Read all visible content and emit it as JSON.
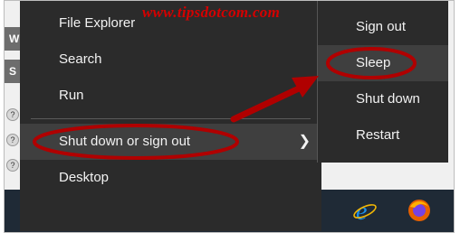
{
  "watermark": "www.tipsdotcom.com",
  "background_window": {
    "tabs": [
      "W",
      "S"
    ]
  },
  "start_menu": {
    "items": [
      {
        "label": "File Explorer"
      },
      {
        "label": "Search"
      },
      {
        "label": "Run"
      },
      {
        "label": "Shut down or sign out"
      },
      {
        "label": "Desktop"
      }
    ]
  },
  "power_submenu": {
    "items": [
      {
        "label": "Sign out"
      },
      {
        "label": "Sleep"
      },
      {
        "label": "Shut down"
      },
      {
        "label": "Restart"
      }
    ]
  },
  "taskbar": {
    "icons": [
      "windows-start-icon",
      "task-view-icon",
      "app-icon",
      "media-icon",
      "edge-icon",
      "file-explorer-icon",
      "internet-explorer-icon",
      "firefox-icon"
    ]
  },
  "colors": {
    "menu_bg": "#2b2b2b",
    "menu_highlight": "#3f3f3f",
    "annotation": "#b00000",
    "watermark": "#d40000",
    "taskbar": "#1f2a36"
  }
}
